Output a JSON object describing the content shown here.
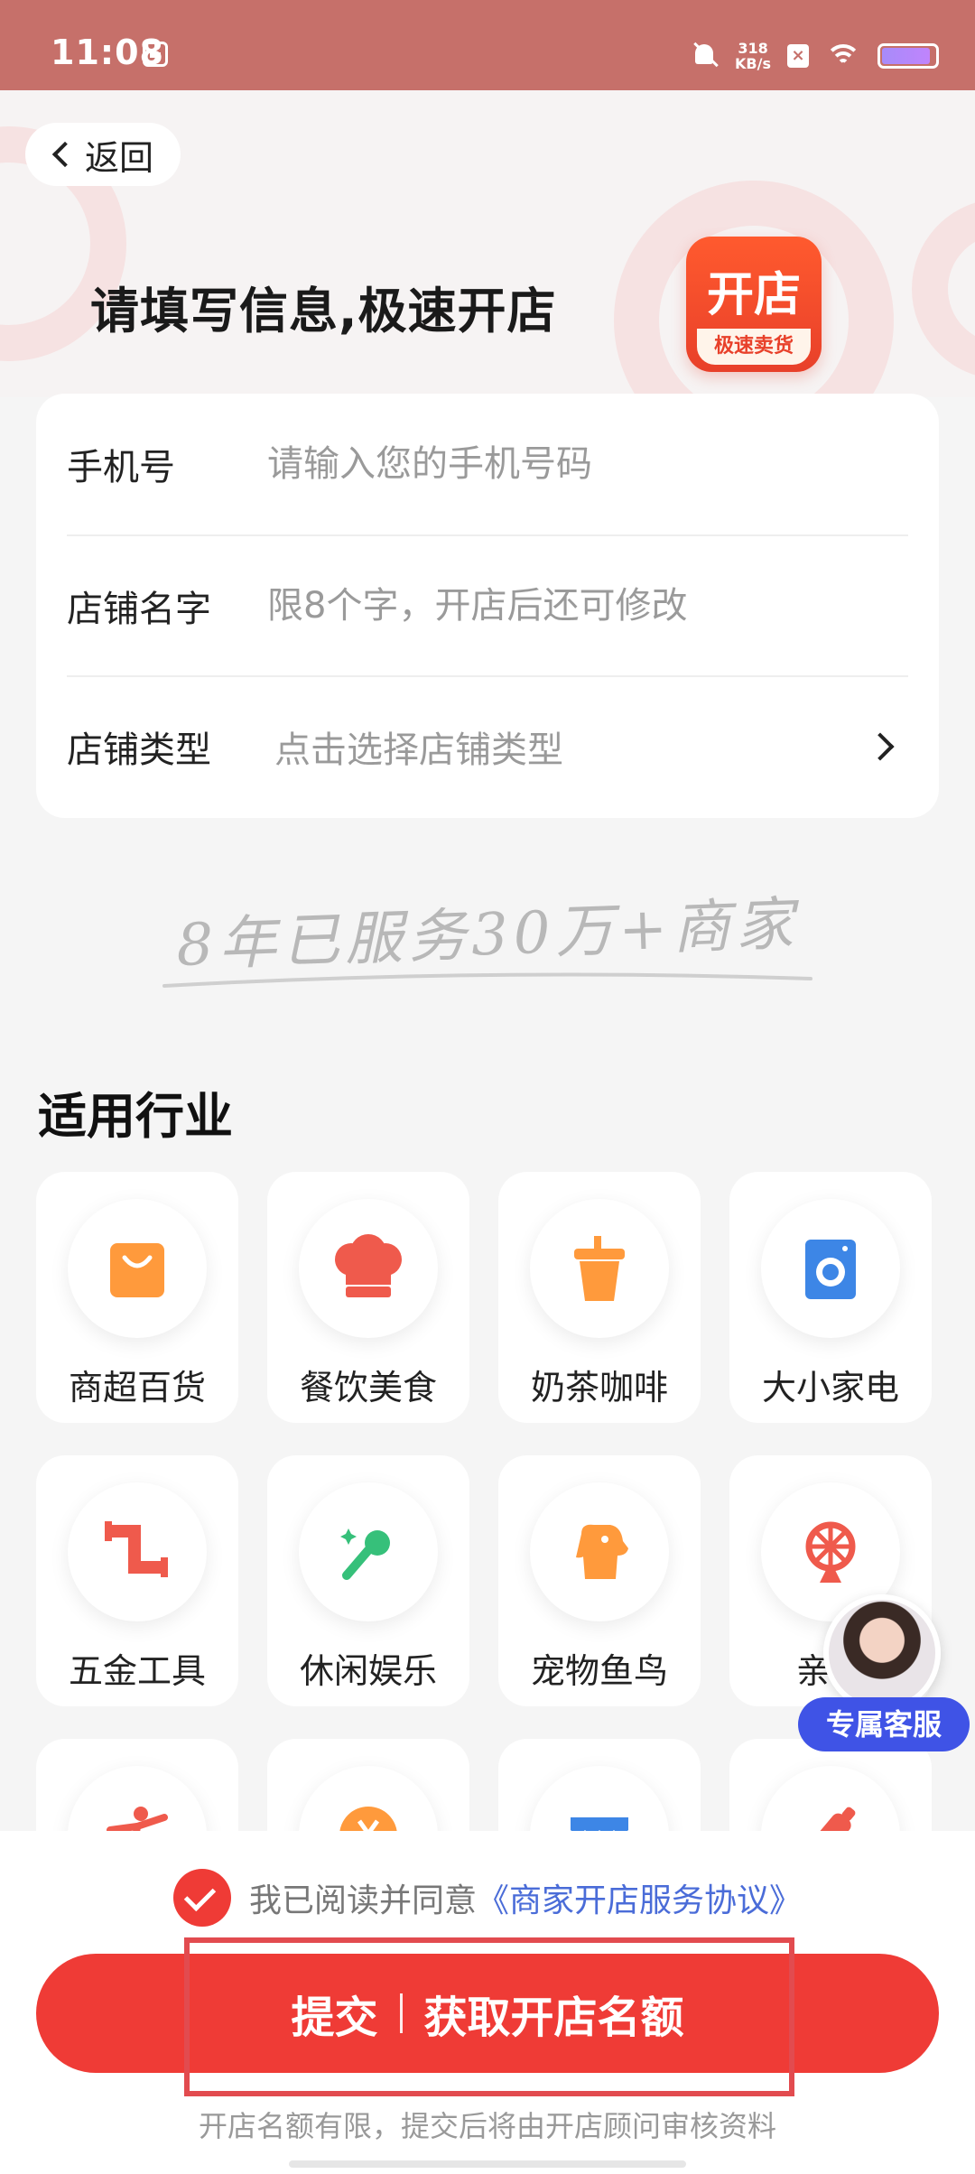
{
  "status_bar": {
    "time": "11:08",
    "speed_value": "318",
    "speed_unit": "KB/s",
    "x_badge": "×",
    "battery_color": "#a78bfa"
  },
  "header": {
    "back_label": "返回",
    "headline": "请填写信息,极速开店",
    "logo_main": "开店",
    "logo_sub": "极速卖货"
  },
  "form": {
    "phone": {
      "label": "手机号",
      "placeholder": "请输入您的手机号码",
      "value": ""
    },
    "shop_name": {
      "label": "店铺名字",
      "placeholder": "限8个字，开店后还可修改",
      "value": ""
    },
    "shop_type": {
      "label": "店铺类型",
      "placeholder": "点击选择店铺类型"
    }
  },
  "slogan": "8年已服务30万+商家",
  "industries": {
    "title": "适用行业",
    "items": [
      {
        "label": "商超百货",
        "icon": "shopping-bag-icon",
        "color": "#ff9a3c"
      },
      {
        "label": "餐饮美食",
        "icon": "chef-hat-icon",
        "color": "#ef5a4c"
      },
      {
        "label": "奶茶咖啡",
        "icon": "drink-cup-icon",
        "color": "#ff9a3c"
      },
      {
        "label": "大小家电",
        "icon": "washing-machine-icon",
        "color": "#3d86e6"
      },
      {
        "label": "五金工具",
        "icon": "pipe-icon",
        "color": "#ef5a4c"
      },
      {
        "label": "休闲娱乐",
        "icon": "microphone-icon",
        "color": "#36c07a"
      },
      {
        "label": "宠物鱼鸟",
        "icon": "dog-icon",
        "color": "#ff9a3c"
      },
      {
        "label": "亲子",
        "icon": "ferris-wheel-icon",
        "color": "#ef5a4c"
      },
      {
        "label": "",
        "icon": "dance-icon",
        "color": "#ef5a4c"
      },
      {
        "label": "",
        "icon": "coin-icon",
        "color": "#ff9a3c"
      },
      {
        "label": "",
        "icon": "awning-icon",
        "color": "#3d86e6"
      },
      {
        "label": "",
        "icon": "bottle-icon",
        "color": "#ef5a4c"
      }
    ]
  },
  "customer_service": {
    "label": "专属客服"
  },
  "bottom": {
    "agree_text": "我已阅读并同意",
    "agree_link": "《商家开店服务协议》",
    "submit_left": "提交",
    "submit_right": "获取开店名额",
    "note": "开店名额有限，提交后将由开店顾问审核资料"
  }
}
